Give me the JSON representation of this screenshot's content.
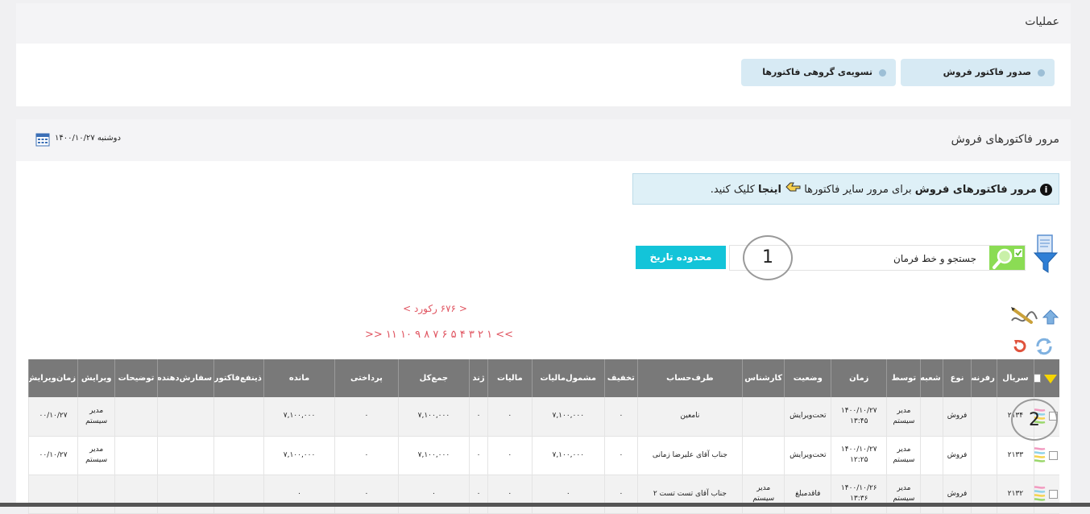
{
  "operations": {
    "title": "عملیات",
    "buttons": [
      {
        "label": "صدور فاکتور فروش"
      },
      {
        "label": "تسویه‌ی گروهی فاکتورها"
      }
    ]
  },
  "review": {
    "title": "مرور فاکتورهای فروش",
    "date": "دوشنبه ۱۴۰۰/۱۰/۲۷",
    "info": {
      "bold": "مرور فاکتورهای فروش",
      "middle": "برای مرور سایر فاکتورها",
      "link": "اینجا",
      "end": "کلیک کنید."
    },
    "search": {
      "value": "جستجو و خط فرمان"
    },
    "date_range_button": "محدوده تاریخ",
    "annotation_1": "1",
    "annotation_2": "2",
    "record_count": "< ۶۷۶ رکورد >",
    "pages": ">> ۱ ۲ ۳ ۴ ۵ ۶ ۷ ۸ ۹ ۱۰ ۱۱ <<"
  },
  "table": {
    "headers": [
      "",
      "سریال",
      "رفرنس",
      "نوع",
      "شعبه",
      "توسط",
      "زمان",
      "وضعیت",
      "کارشناس",
      "طرف‌حساب",
      "تخفیف",
      "مشمول‌مالیات",
      "مالیات",
      "ژند",
      "جمع‌کل",
      "پرداختی",
      "مانده",
      "ذینفع‌فاکتور",
      "سفارش‌دهنده",
      "توضیحات",
      "ویرایش",
      "زمان‌ویرایش"
    ],
    "rows": [
      {
        "serial": "۲۱۳۴",
        "ref": "",
        "type": "فروش",
        "branch": "",
        "by1": "مدیر",
        "by2": "سیستم",
        "time1": "۱۴۰۰/۱۰/۲۷",
        "time2": "۱۳:۴۵",
        "status": "تحت‌ویرایش",
        "expert1": "",
        "expert2": "",
        "party": "نامعین",
        "discount": "۰",
        "taxable": "۷,۱۰۰,۰۰۰",
        "tax": "۰",
        "round": "۰",
        "total": "۷,۱۰۰,۰۰۰",
        "paid": "۰",
        "remain": "۷,۱۰۰,۰۰۰",
        "beneficiary": "",
        "orderer": "",
        "desc": "",
        "edit1": "مدیر",
        "edit2": "سیستم",
        "edittime": "۰۰/۱۰/۲۷"
      },
      {
        "serial": "۲۱۳۳",
        "ref": "",
        "type": "فروش",
        "branch": "",
        "by1": "مدیر",
        "by2": "سیستم",
        "time1": "۱۴۰۰/۱۰/۲۷",
        "time2": "۱۲:۲۵",
        "status": "تحت‌ویرایش",
        "expert1": "",
        "expert2": "",
        "party": "جناب آقای علیرضا زمانی",
        "discount": "۰",
        "taxable": "۷,۱۰۰,۰۰۰",
        "tax": "۰",
        "round": "۰",
        "total": "۷,۱۰۰,۰۰۰",
        "paid": "۰",
        "remain": "۷,۱۰۰,۰۰۰",
        "beneficiary": "",
        "orderer": "",
        "desc": "",
        "edit1": "مدیر",
        "edit2": "سیستم",
        "edittime": "۰۰/۱۰/۲۷"
      },
      {
        "serial": "۲۱۳۲",
        "ref": "",
        "type": "فروش",
        "branch": "",
        "by1": "مدیر",
        "by2": "سیستم",
        "time1": "۱۴۰۰/۱۰/۲۶",
        "time2": "۱۳:۳۶",
        "status": "فاقدمبلغ",
        "expert1": "مدیر",
        "expert2": "سیستم",
        "party": "جناب آقای تست تست ۲",
        "discount": "۰",
        "taxable": "۰",
        "tax": "۰",
        "round": "۰",
        "total": "۰",
        "paid": "۰",
        "remain": "۰",
        "beneficiary": "",
        "orderer": "",
        "desc": "",
        "edit1": "",
        "edit2": "",
        "edittime": ""
      }
    ]
  }
}
